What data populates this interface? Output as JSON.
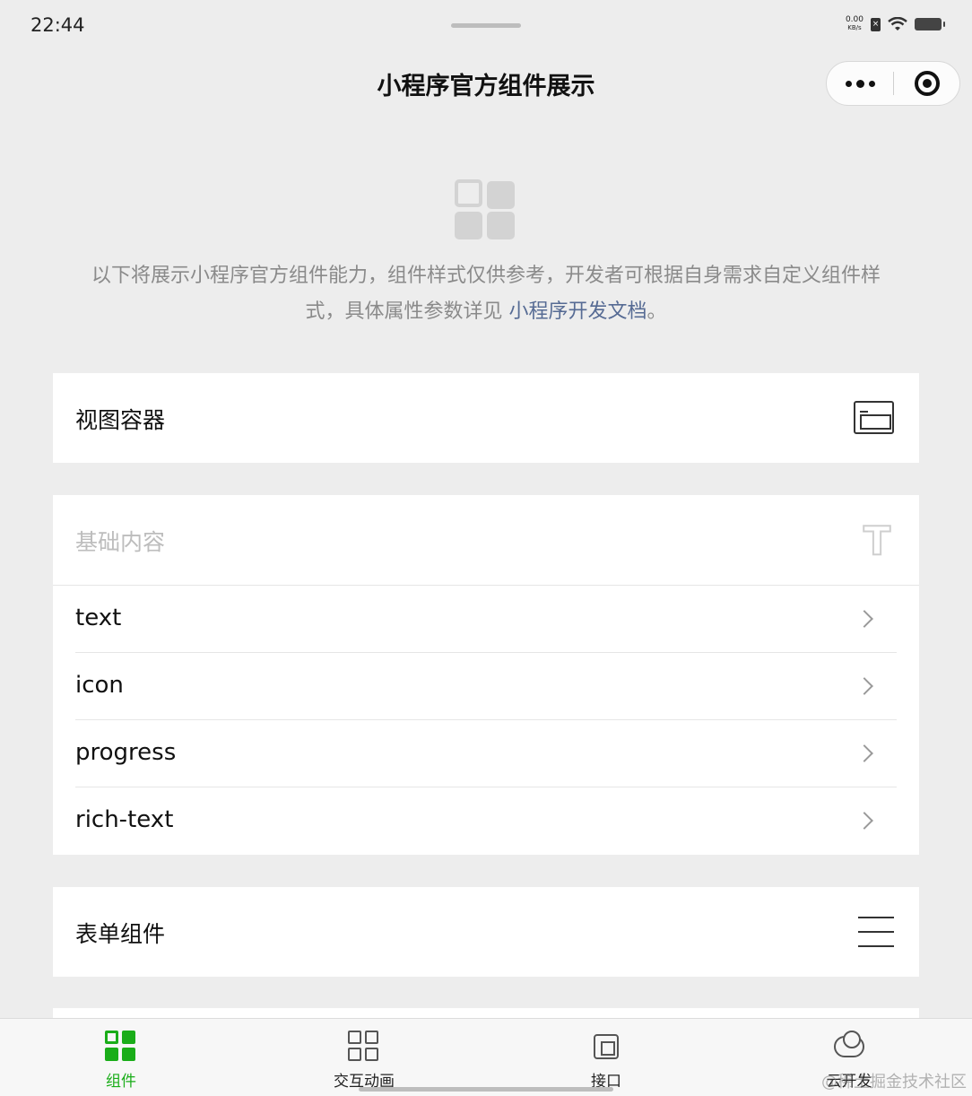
{
  "status_bar": {
    "time": "22:44",
    "net_speed": "0.00",
    "net_unit": "KB/s"
  },
  "nav": {
    "title": "小程序官方组件展示",
    "more_icon": "more-dots-icon",
    "close_icon": "target-icon"
  },
  "intro": {
    "text": "以下将展示小程序官方组件能力，组件样式仅供参考，开发者可根据自身需求自定义组件样式，具体属性参数详见",
    "link": "小程序开发文档",
    "end": "。"
  },
  "sections": {
    "view": {
      "title": "视图容器",
      "icon": "view-container-icon"
    },
    "basic": {
      "title": "基础内容",
      "icon": "text-t-icon",
      "items": [
        "text",
        "icon",
        "progress",
        "rich-text"
      ]
    },
    "form": {
      "title": "表单组件",
      "icon": "form-lines-icon"
    }
  },
  "tabbar": {
    "tabs": [
      {
        "label": "组件",
        "icon": "grid-icon",
        "active": true
      },
      {
        "label": "交互动画",
        "icon": "grid-outline-icon",
        "active": false
      },
      {
        "label": "接口",
        "icon": "chip-icon",
        "active": false
      },
      {
        "label": "云开发",
        "icon": "cloud-icon",
        "active": false
      }
    ]
  },
  "watermark": "@稀土掘金技术社区",
  "colors": {
    "accent": "#1aad19",
    "link": "#566b94",
    "background": "#ededed"
  }
}
